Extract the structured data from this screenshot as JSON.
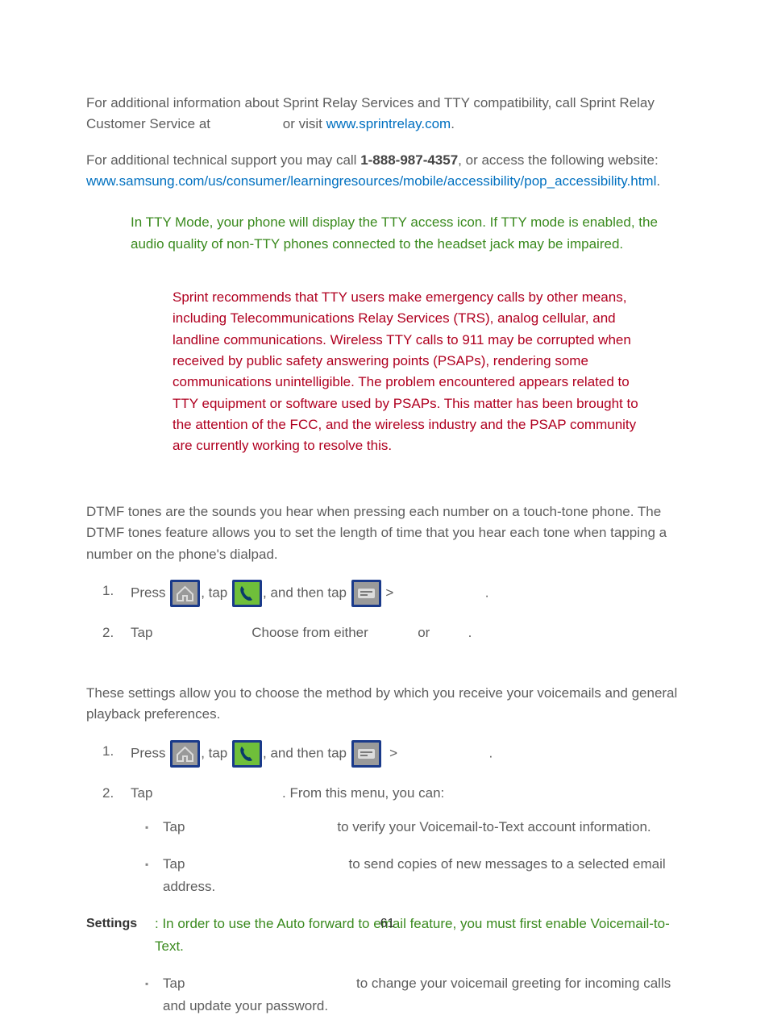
{
  "p1": {
    "before_phone": "For additional information about Sprint Relay Services and TTY compatibility, call Sprint Relay Customer Service at ",
    "after_phone_before_link": " or visit ",
    "link": "www.sprintrelay.com",
    "end": "."
  },
  "p2": {
    "before_num": "For additional technical support you may call ",
    "num": "1-888-987-4357",
    "after_num": ", or access the following website: ",
    "link": "www.samsung.com/us/consumer/learningresources/mobile/accessibility/pop_accessibility.html",
    "end": "."
  },
  "note_green": "In TTY Mode, your phone will display the TTY access icon. If TTY mode is enabled, the audio quality of non-TTY phones connected to the headset jack may be impaired.",
  "note_red": "Sprint recommends that TTY users make emergency calls by other means, including Telecommunications Relay Services (TRS), analog cellular, and landline communications. Wireless TTY calls to 911 may be corrupted when received by public safety answering points (PSAPs), rendering some communications unintelligible. The problem encountered appears related to TTY equipment or software used by PSAPs. This matter has been brought to the attention of the FCC, and the wireless industry and the PSAP community are currently working to resolve this.",
  "dtmf_intro": "DTMF tones are the sounds you hear when pressing each number on a touch-tone phone. The DTMF tones feature allows you to set the length of time that you hear each tone when tapping a number on the phone's dialpad.",
  "steps_parts": {
    "press": "Press ",
    "comma_tap": ", tap ",
    "and_then_tap": ", and then tap ",
    "chev": " > ",
    "period": " ."
  },
  "dtmf_step2": {
    "tap": "Tap ",
    "choose": "Choose from either ",
    "or": " or ",
    "end": " ."
  },
  "vm_intro": "These settings allow you to choose the method by which you receive your voicemails and general playback preferences.",
  "vm_step2": {
    "tap": "Tap ",
    "from_menu": ". From this menu, you can:"
  },
  "vm_sub": {
    "a_tap": "Tap ",
    "a_rest": " to verify your Voicemail-to-Text account information.",
    "b_tap": "Tap ",
    "b_rest": " to send copies of new messages to a selected email address.",
    "c_tap": "Tap ",
    "c_rest": " to change your voicemail greeting for incoming calls and update your password."
  },
  "vm_subnote": {
    "colon": ": ",
    "text": "In order to use the Auto forward to email feature, you must first enable Voicemail-to-Text."
  },
  "footer": {
    "section": "Settings",
    "page": "61"
  }
}
